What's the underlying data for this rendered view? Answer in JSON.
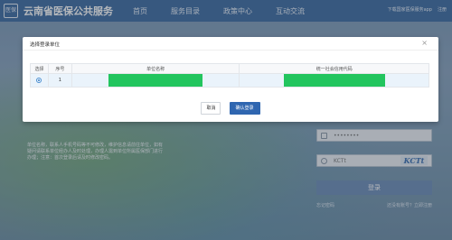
{
  "header": {
    "logo_text": "医保",
    "site_title": "云南省医保公共服务",
    "nav": [
      "首页",
      "服务目录",
      "政策中心",
      "互动交流"
    ],
    "right_links": [
      "下载国家医保服务app",
      "注册"
    ]
  },
  "background": {
    "notice_text": "单位名称，联系人手机号码等不可修改，维护信息请前往单位，如有疑问请联系单位经办人及时处理，办理人需到单位所属医保部门进行办理；注意：首次登录后请及时修改密码。"
  },
  "login": {
    "password_placeholder": "••••••••",
    "captcha_placeholder": "KCTt",
    "captcha_image_text": "KCTt",
    "submit_label": "登录",
    "link_left": "忘记密码",
    "link_right": "还没有账号？立即注册"
  },
  "modal": {
    "title": "选择登录单位",
    "close": "×",
    "columns": [
      "选择",
      "序号",
      "单位名称",
      "统一社会信用代码"
    ],
    "rows": [
      {
        "selected": true,
        "index": "1",
        "unit_name": "",
        "credit_code": ""
      }
    ],
    "cancel_label": "取消",
    "confirm_label": "确认登录"
  },
  "colors": {
    "header_bg": "#3f6da3",
    "confirm_btn": "#2f66b0",
    "redaction": "#22c55e"
  }
}
